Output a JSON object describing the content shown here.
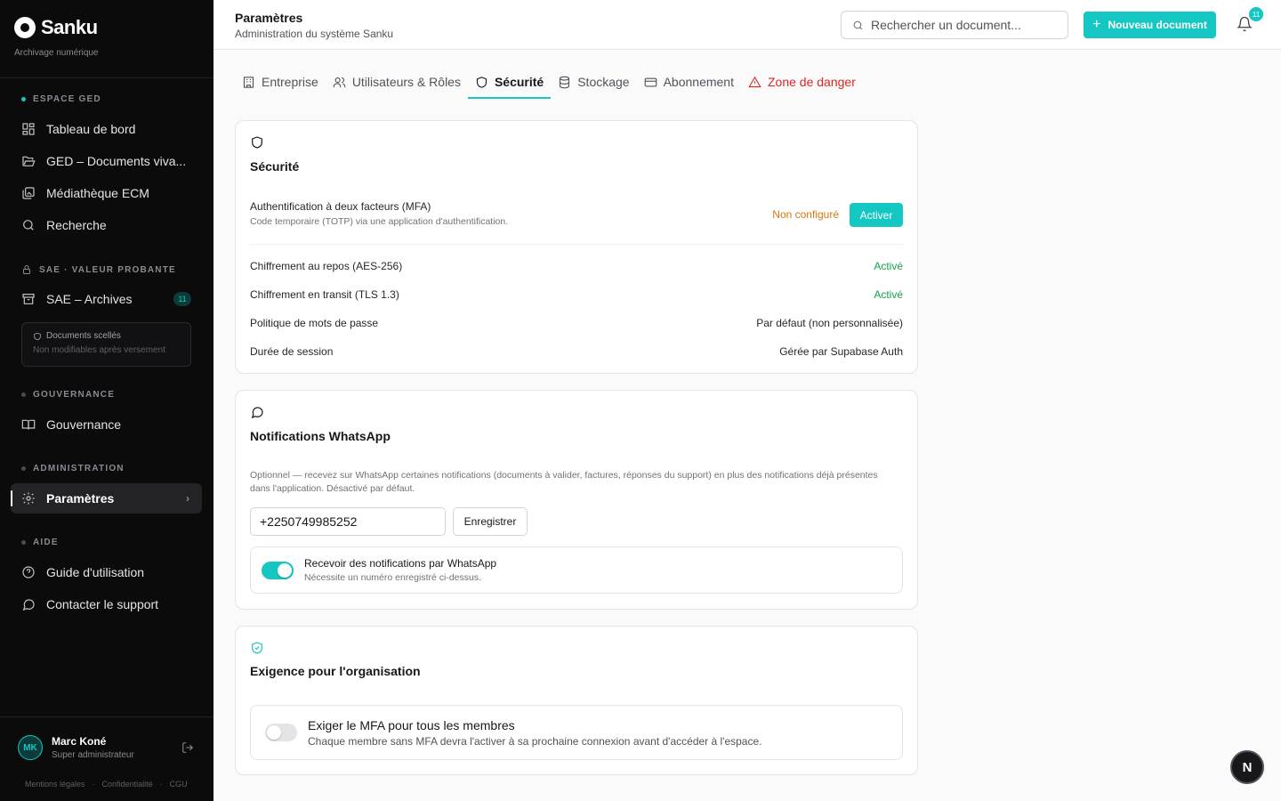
{
  "brand": {
    "name": "Sanku",
    "subtitle": "Archivage numérique"
  },
  "sidebar": {
    "sections": [
      {
        "title": "ESPACE GED"
      },
      {
        "title": "SAE · VALEUR PROBANTE"
      },
      {
        "title": "GOUVERNANCE"
      },
      {
        "title": "ADMINISTRATION"
      },
      {
        "title": "AIDE"
      }
    ],
    "items": [
      {
        "label": "Tableau de bord"
      },
      {
        "label": "GED – Documents viva..."
      },
      {
        "label": "Médiathèque ECM"
      },
      {
        "label": "Recherche"
      },
      {
        "label": "SAE – Archives",
        "badge": "11"
      },
      {
        "label": "Gouvernance"
      },
      {
        "label": "Paramètres"
      },
      {
        "label": "Guide d'utilisation"
      },
      {
        "label": "Contacter le support"
      }
    ],
    "sealed": {
      "title": "Documents scellés",
      "subtitle": "Non modifiables après versement"
    },
    "user": {
      "initials": "MK",
      "name": "Marc Koné",
      "role": "Super administrateur"
    },
    "footer": [
      "Mentions légales",
      "·",
      "Confidentialité",
      "·",
      "CGU"
    ]
  },
  "header": {
    "title": "Paramètres",
    "subtitle": "Administration du système Sanku",
    "search_placeholder": "Rechercher un document...",
    "new_doc_label": "Nouveau document",
    "notif_count": "11"
  },
  "tabs": [
    {
      "label": "Entreprise"
    },
    {
      "label": "Utilisateurs & Rôles"
    },
    {
      "label": "Sécurité"
    },
    {
      "label": "Stockage"
    },
    {
      "label": "Abonnement"
    },
    {
      "label": "Zone de danger"
    }
  ],
  "security": {
    "title": "Sécurité",
    "mfa": {
      "label": "Authentification à deux facteurs (MFA)",
      "desc": "Code temporaire (TOTP) via une application d'authentification.",
      "status": "Non configuré",
      "button": "Activer"
    },
    "rows": [
      {
        "label": "Chiffrement au repos (AES-256)",
        "value": "Activé"
      },
      {
        "label": "Chiffrement en transit (TLS 1.3)",
        "value": "Activé"
      },
      {
        "label": "Politique de mots de passe",
        "value": "Par défaut (non personnalisée)"
      },
      {
        "label": "Durée de session",
        "value": "Gérée par Supabase Auth"
      }
    ]
  },
  "whatsapp": {
    "title": "Notifications WhatsApp",
    "desc": "Optionnel — recevez sur WhatsApp certaines notifications (documents à valider, factures, réponses du support) en plus des notifications déjà présentes dans l'application. Désactivé par défaut.",
    "phone": "+2250749985252",
    "save_label": "Enregistrer",
    "toggle_label": "Recevoir des notifications par WhatsApp",
    "toggle_desc": "Nécessite un numéro enregistré ci-dessus.",
    "toggle_on": true
  },
  "org": {
    "title": "Exigence pour l'organisation",
    "toggle_label": "Exiger le MFA pour tous les membres",
    "toggle_desc": "Chaque membre sans MFA devra l'activer à sa prochaine connexion avant d'accéder à l'espace.",
    "toggle_on": false
  },
  "fab_label": "N",
  "colors": {
    "accent": "#14c7c2",
    "danger": "#dc2626",
    "success": "#16a34a",
    "warning": "#d97706",
    "sidebar_bg": "#0b0b0c"
  }
}
